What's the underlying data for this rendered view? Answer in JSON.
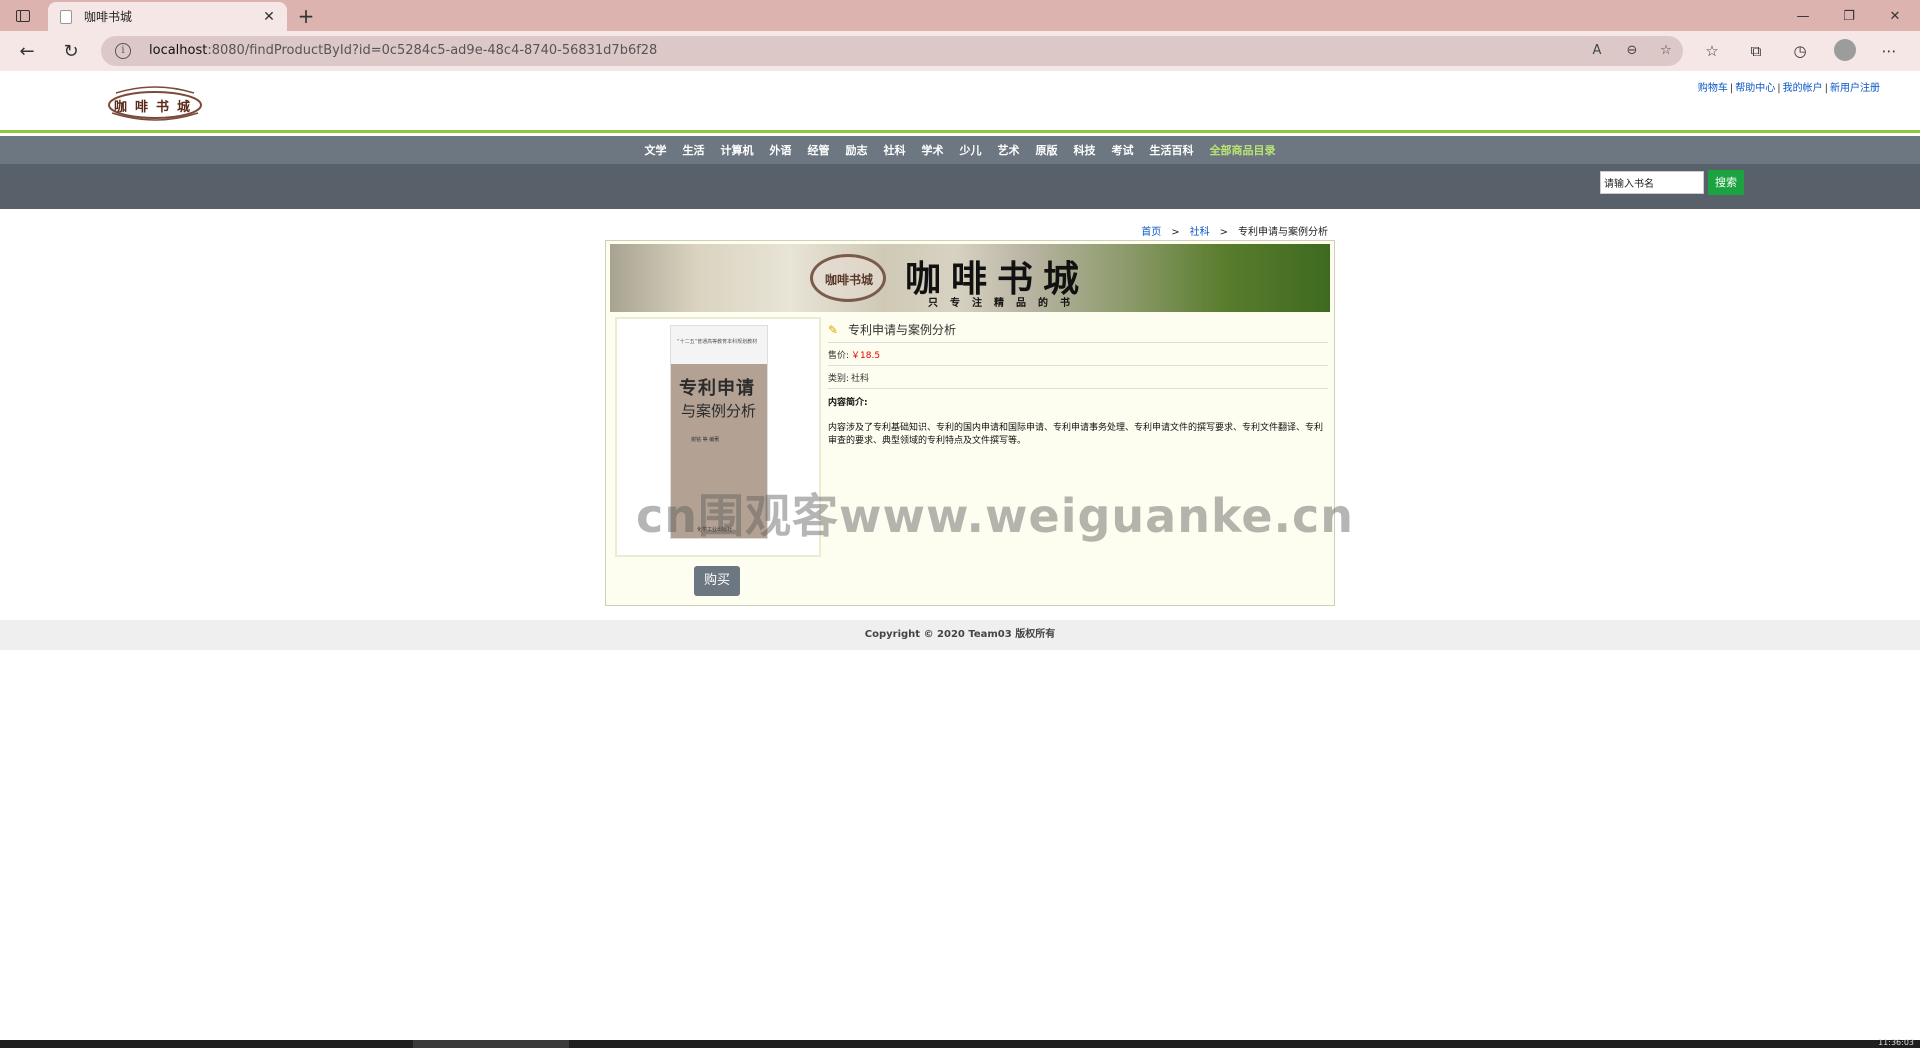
{
  "browser": {
    "tab_title": "咖啡书城",
    "url_host": "localhost",
    "url_path": ":8080/findProductById?id=0c5284c5-ad9e-48c4-8740-56831d7b6f28"
  },
  "header": {
    "links": [
      "购物车",
      "帮助中心",
      "我的帐户",
      "新用户注册"
    ],
    "logo_text": "咖啡书城"
  },
  "categories": [
    "文学",
    "生活",
    "计算机",
    "外语",
    "经管",
    "励志",
    "社科",
    "学术",
    "少儿",
    "艺术",
    "原版",
    "科技",
    "考试",
    "生活百科",
    "全部商品目录"
  ],
  "search": {
    "value": "请输入书名",
    "button": "搜索"
  },
  "breadcrumb": {
    "home": "首页",
    "category": "社科",
    "current": "专利申请与案例分析",
    "sep": ">"
  },
  "banner": {
    "brand": "咖啡书城",
    "slogan": "只专注精品的书",
    "seal": "咖啡书城"
  },
  "book_cover": {
    "series": "“十二五”普通高等教育本科规划教材",
    "title1": "专利申请",
    "title2": "与案例分析",
    "authors": "谢铭 等 编著",
    "publisher": "化学工业出版社"
  },
  "product": {
    "name": "专利申请与案例分析",
    "price_label": "售价:",
    "price": "￥18.5",
    "category_label": "类别:",
    "category": "社科",
    "intro_label": "内容简介:",
    "description": "内容涉及了专利基础知识、专利的国内申请和国际申请、专利申请事务处理、专利申请文件的撰写要求、专利文件翻译、专利审查的要求、典型领域的专利特点及文件撰写等。",
    "buy_label": "购买"
  },
  "watermark": "cn围观客www.weiguanke.cn",
  "footer": {
    "copyright": "Copyright © 2020 Team03 版权所有"
  },
  "taskbar": {
    "clock": "11:36:03"
  }
}
